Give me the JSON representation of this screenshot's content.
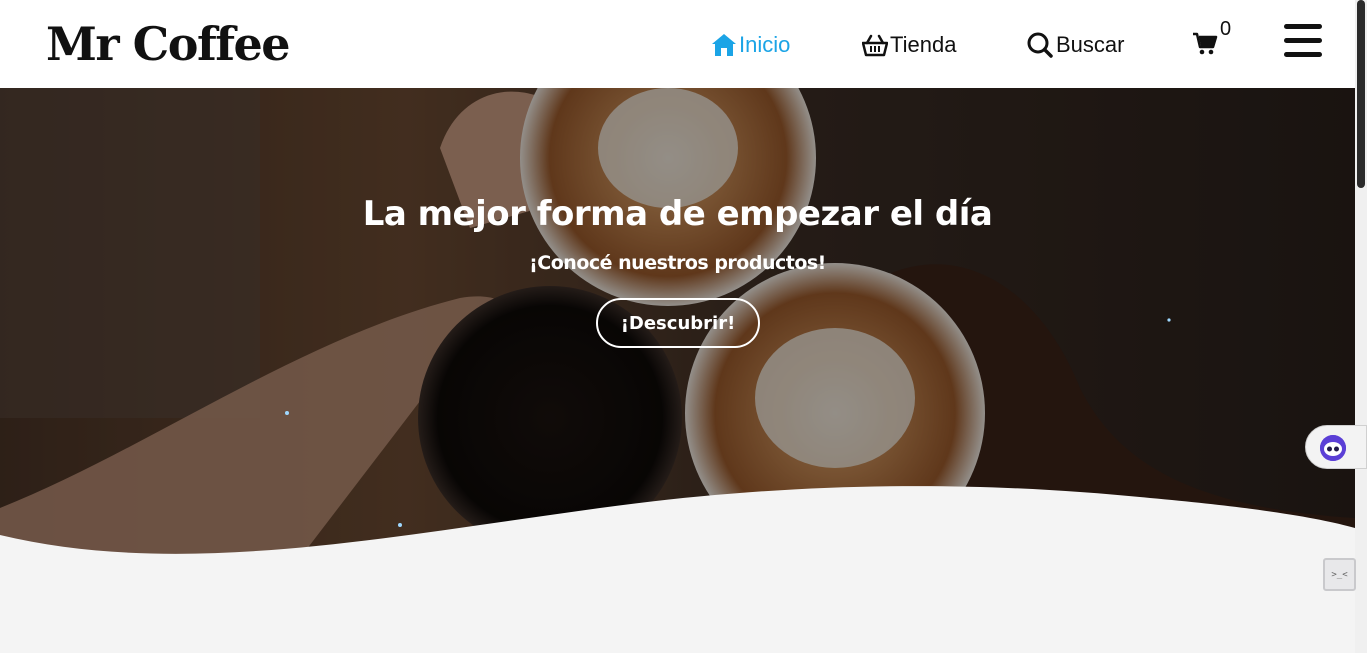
{
  "header": {
    "logo": "Mr Coffee",
    "nav": [
      {
        "label": "Inicio",
        "icon": "home-icon",
        "active": true
      },
      {
        "label": "Tienda",
        "icon": "basket-icon",
        "active": false
      },
      {
        "label": "Buscar",
        "icon": "search-icon",
        "active": false
      }
    ],
    "cart_count": "0",
    "menu_icon": "hamburger-icon"
  },
  "hero": {
    "title": "La mejor forma de empezar el día",
    "subtitle": "¡Conocé nuestros productos!",
    "button": "¡Descubrir!"
  },
  "widgets": {
    "console_glyph": ">_<"
  },
  "colors": {
    "accent": "#1ba4e6",
    "header_bg": "#ffffff",
    "page_bg": "#f4f4f4",
    "text": "#111111"
  }
}
